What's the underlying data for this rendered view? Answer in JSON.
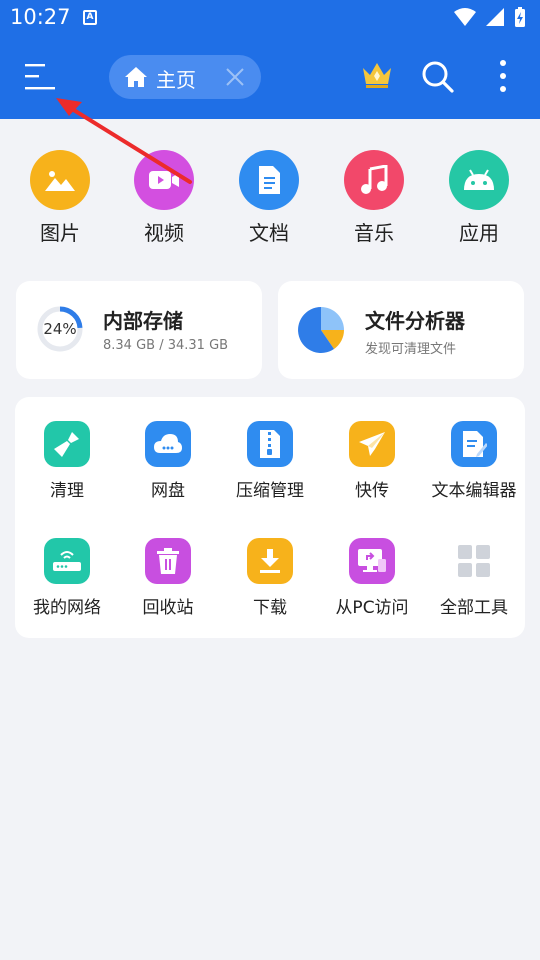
{
  "status_bar": {
    "time": "10:27",
    "notif_glyph": "A"
  },
  "toolbar": {
    "menu_icon": "hamburger-menu-icon",
    "tab_label": "主页",
    "crown_icon": "crown-icon",
    "search_icon": "search-icon",
    "more_icon": "more-vert-icon"
  },
  "categories": [
    {
      "label": "图片",
      "icon": "image-icon",
      "color": "#f7b21b"
    },
    {
      "label": "视频",
      "icon": "video-icon",
      "color": "#d34fe0"
    },
    {
      "label": "文档",
      "icon": "document-icon",
      "color": "#2f8cf0"
    },
    {
      "label": "音乐",
      "icon": "music-icon",
      "color": "#f2486a"
    },
    {
      "label": "应用",
      "icon": "android-icon",
      "color": "#25c7a5"
    }
  ],
  "storage": {
    "percent_label": "24%",
    "percent": 24,
    "title": "内部存储",
    "usage": "8.34 GB / 34.31 GB"
  },
  "analyzer": {
    "title": "文件分析器",
    "subtitle": "发现可清理文件"
  },
  "tools": [
    {
      "label": "清理",
      "icon": "broom-icon",
      "color": "#22c7a9"
    },
    {
      "label": "网盘",
      "icon": "cloud-drive-icon",
      "color": "#2f8cf0"
    },
    {
      "label": "压缩管理",
      "icon": "zip-icon",
      "color": "#2f8cf0"
    },
    {
      "label": "快传",
      "icon": "paper-plane-icon",
      "color": "#f7b21b"
    },
    {
      "label": "文本编辑器",
      "icon": "text-editor-icon",
      "color": "#2f8cf0"
    },
    {
      "label": "我的网络",
      "icon": "router-icon",
      "color": "#22c7a9"
    },
    {
      "label": "回收站",
      "icon": "trash-icon",
      "color": "#c84fe0"
    },
    {
      "label": "下载",
      "icon": "download-icon",
      "color": "#f7b21b"
    },
    {
      "label": "从PC访问",
      "icon": "pc-access-icon",
      "color": "#c84fe0"
    },
    {
      "label": "全部工具",
      "icon": "grid-icon",
      "color": "#cfd3da"
    }
  ]
}
